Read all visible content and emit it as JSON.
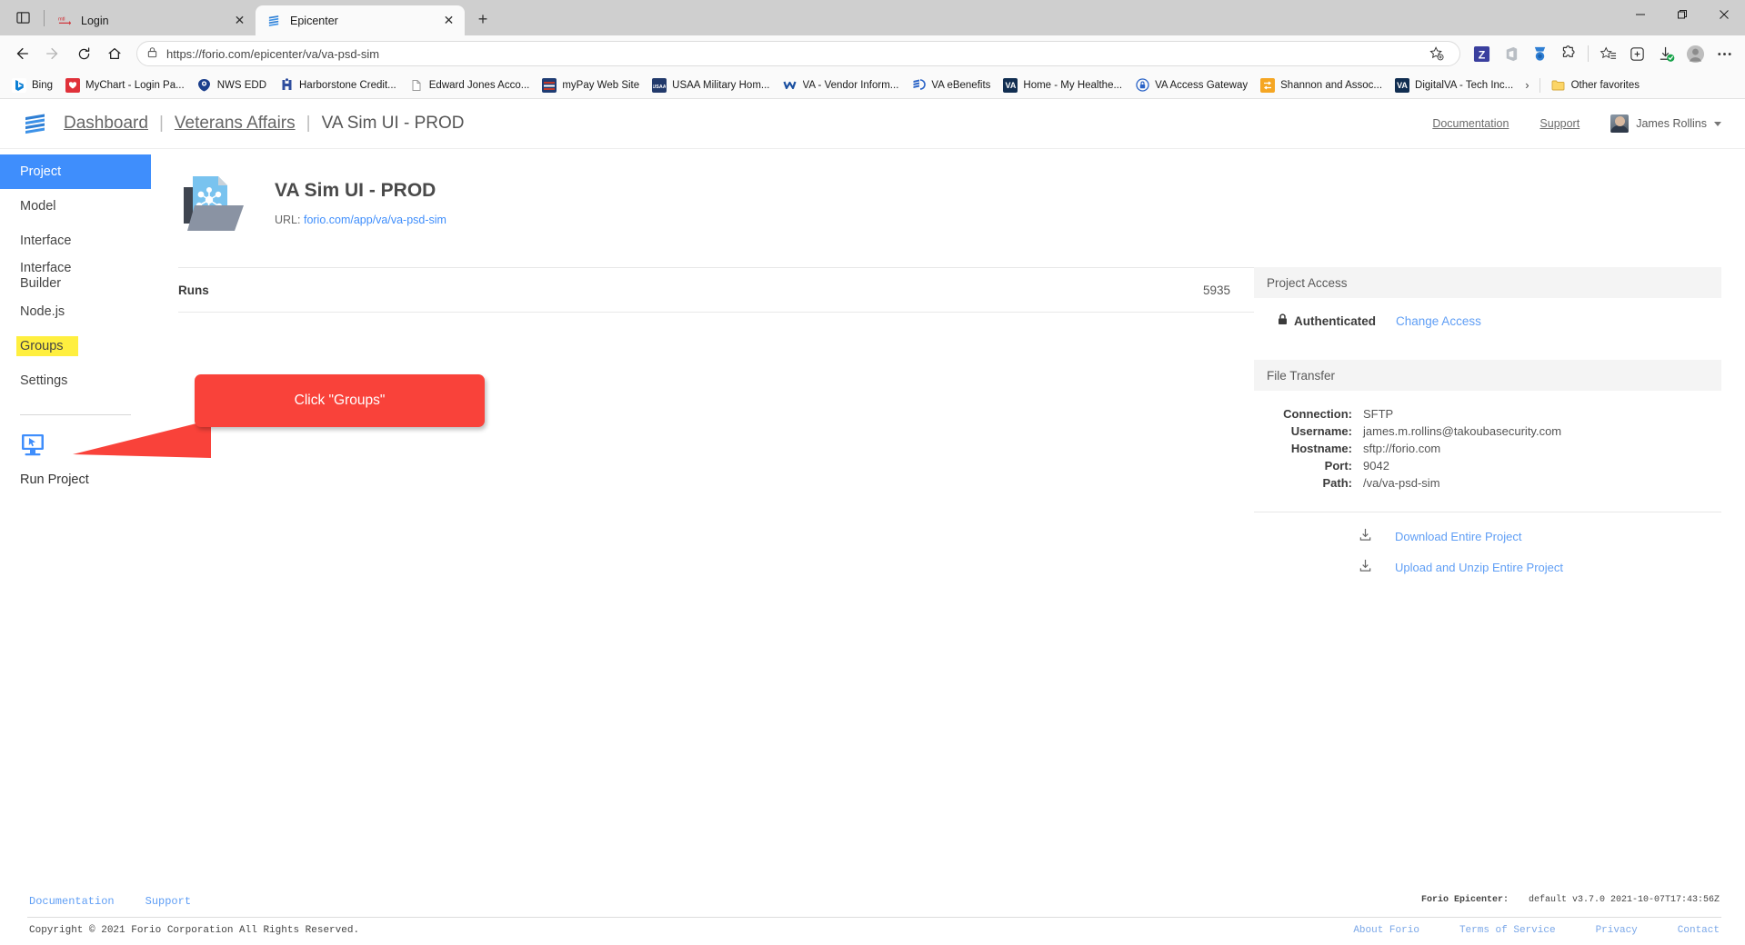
{
  "browser": {
    "tabs": [
      {
        "title": "Login",
        "icon": "mychart-icon",
        "active": false
      },
      {
        "title": "Epicenter",
        "icon": "forio-icon",
        "active": true
      }
    ],
    "new_tab_label": "+",
    "window_controls": {
      "minimize": "—",
      "maximize": "❐",
      "close": "✕"
    },
    "nav": {
      "back": "←",
      "forward": "→",
      "reload": "↻",
      "home": "⌂"
    },
    "omnibox": {
      "lock_icon": "lock-icon",
      "url_prefix": "https://",
      "url_domain": "forio.com",
      "url_path": "/epicenter/va/va-psd-sim",
      "full_url": "https://forio.com/epicenter/va/va-psd-sim"
    },
    "toolbar_icons": [
      "add-favorite-icon",
      "zotero-icon",
      "office-icon",
      "collections-icon",
      "extensions-icon",
      "favorites-icon",
      "collections-add-icon",
      "downloads-complete-icon",
      "profile-icon",
      "settings-more-icon"
    ],
    "bookmarks": [
      {
        "label": "Bing",
        "icon_text": "b",
        "icon_color": "#ffffff",
        "text_color": "#0c7fd4"
      },
      {
        "label": "MyChart - Login Pa...",
        "icon_text": "",
        "icon_color": "#e0313a",
        "text_color": "#fff"
      },
      {
        "label": "NWS EDD",
        "icon_text": "",
        "icon_color": "#1b3f8c",
        "text_color": "#fff"
      },
      {
        "label": "Harborstone Credit...",
        "icon_text": "",
        "icon_color": "#2e4d9e",
        "text_color": "#fff"
      },
      {
        "label": "Edward Jones Acco...",
        "icon_text": "",
        "icon_color": "#ffffff",
        "text_color": "#888"
      },
      {
        "label": "myPay Web Site",
        "icon_text": "",
        "icon_color": "#1f3c73",
        "text_color": "#fff"
      },
      {
        "label": "USAA Military Hom...",
        "icon_text": "",
        "icon_color": "#223a6b",
        "text_color": "#fff"
      },
      {
        "label": "VA - Vendor Inform...",
        "icon_text": "",
        "icon_color": "#ffffff",
        "text_color": "#1a4fa0"
      },
      {
        "label": "VA eBenefits",
        "icon_text": "",
        "icon_color": "#ffffff",
        "text_color": "#2a63c7"
      },
      {
        "label": "Home - My Healthe...",
        "icon_text": "VA",
        "icon_color": "#112e51",
        "text_color": "#fff"
      },
      {
        "label": "VA Access Gateway",
        "icon_text": "",
        "icon_color": "#ffffff",
        "text_color": "#2a63c7"
      },
      {
        "label": "Shannon and Assoc...",
        "icon_text": "",
        "icon_color": "#f5a623",
        "text_color": "#fff"
      },
      {
        "label": "DigitalVA - Tech Inc...",
        "icon_text": "VA",
        "icon_color": "#112e51",
        "text_color": "#fff"
      }
    ],
    "bookmarks_overflow": "›",
    "other_favorites": {
      "label": "Other favorites",
      "icon": "folder-icon"
    }
  },
  "header": {
    "logo": "forio-logo-icon",
    "breadcrumb": {
      "dashboard": "Dashboard",
      "sep1": "|",
      "account": "Veterans Affairs",
      "sep2": "|",
      "current": "VA Sim UI - PROD"
    },
    "documentation": "Documentation",
    "support": "Support",
    "user_name": "James Rollins",
    "avatar": "user-avatar"
  },
  "sidebar": {
    "items": [
      {
        "label": "Project",
        "state": "active"
      },
      {
        "label": "Model",
        "state": "normal"
      },
      {
        "label": "Interface",
        "state": "normal"
      },
      {
        "label": "Interface Builder",
        "state": "normal"
      },
      {
        "label": "Node.js",
        "state": "normal"
      },
      {
        "label": "Groups",
        "state": "highlighted"
      },
      {
        "label": "Settings",
        "state": "normal"
      }
    ],
    "run_project": {
      "label": "Run Project",
      "icon": "monitor-cursor-icon"
    }
  },
  "project": {
    "icon": "project-folder-icon",
    "title": "VA Sim UI - PROD",
    "url_label": "URL:",
    "url_value": "forio.com/app/va/va-psd-sim"
  },
  "runs": {
    "label": "Runs",
    "value": "5935"
  },
  "callout": {
    "text": "Click \"Groups\"",
    "color": "#f9423a",
    "points_to": "sidebar-item-groups"
  },
  "project_access": {
    "title": "Project Access",
    "status": "Authenticated",
    "status_icon": "lock-icon",
    "change_link": "Change Access"
  },
  "file_transfer": {
    "title": "File Transfer",
    "fields": [
      {
        "key": "Connection:",
        "value": "SFTP"
      },
      {
        "key": "Username:",
        "value": "james.m.rollins@takoubasecurity.com"
      },
      {
        "key": "Hostname:",
        "value": "sftp://forio.com"
      },
      {
        "key": "Port:",
        "value": "9042"
      },
      {
        "key": "Path:",
        "value": "/va/va-psd-sim"
      }
    ],
    "actions": [
      {
        "label": "Download Entire Project",
        "icon": "download-icon"
      },
      {
        "label": "Upload and Unzip Entire Project",
        "icon": "upload-icon"
      }
    ]
  },
  "footer": {
    "links": [
      {
        "label": "Documentation"
      },
      {
        "label": "Support"
      }
    ],
    "copyright": "Copyright © 2021 Forio Corporation All Rights Reserved.",
    "version_key": "Forio Epicenter:",
    "version_value": "default v3.7.0 2021-10-07T17:43:56Z",
    "bottom_links": [
      {
        "label": "About Forio"
      },
      {
        "label": "Terms of Service"
      },
      {
        "label": "Privacy"
      },
      {
        "label": "Contact"
      }
    ]
  }
}
